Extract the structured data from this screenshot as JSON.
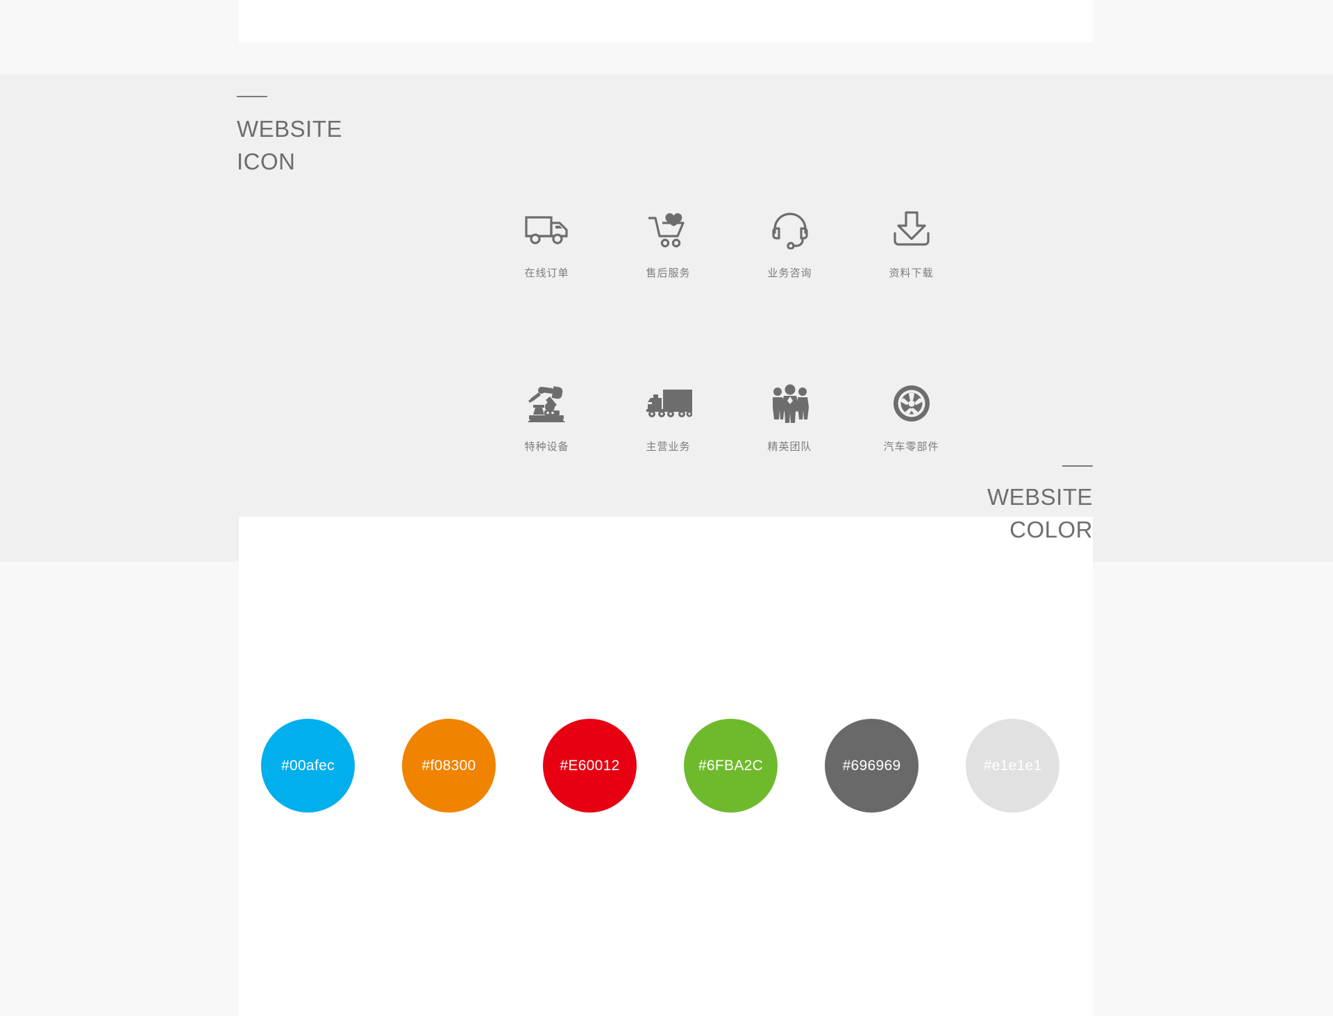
{
  "page": {
    "background": "#f8f8f8",
    "band_background": "#f0f0f0",
    "panel_background": "#ffffff"
  },
  "icon_section": {
    "heading_line1": "WEBSITE",
    "heading_line2": "ICON",
    "rows": [
      [
        {
          "icon": "delivery-truck-icon",
          "label": "在线订单"
        },
        {
          "icon": "shopping-cart-heart-icon",
          "label": "售后服务"
        },
        {
          "icon": "headset-support-icon",
          "label": "业务咨询"
        },
        {
          "icon": "download-tray-icon",
          "label": "资料下载"
        }
      ],
      [
        {
          "icon": "robot-arm-icon",
          "label": "特种设备"
        },
        {
          "icon": "semi-truck-icon",
          "label": "主营业务"
        },
        {
          "icon": "team-people-icon",
          "label": "精英团队"
        },
        {
          "icon": "wheel-rim-icon",
          "label": "汽车零部件"
        }
      ]
    ],
    "icon_color": "#6d6d6d",
    "label_color": "#7c7c7c"
  },
  "color_section": {
    "heading_line1": "WEBSITE",
    "heading_line2": "COLOR",
    "swatches": [
      {
        "label": "#00afec",
        "hex": "#00afec"
      },
      {
        "label": "#f08300",
        "hex": "#f08300"
      },
      {
        "label": "#E60012",
        "hex": "#e60012"
      },
      {
        "label": "#6FBA2C",
        "hex": "#6fba2c"
      },
      {
        "label": "#696969",
        "hex": "#696969"
      },
      {
        "label": "#e1e1e1",
        "hex": "#e1e1e1"
      }
    ]
  }
}
